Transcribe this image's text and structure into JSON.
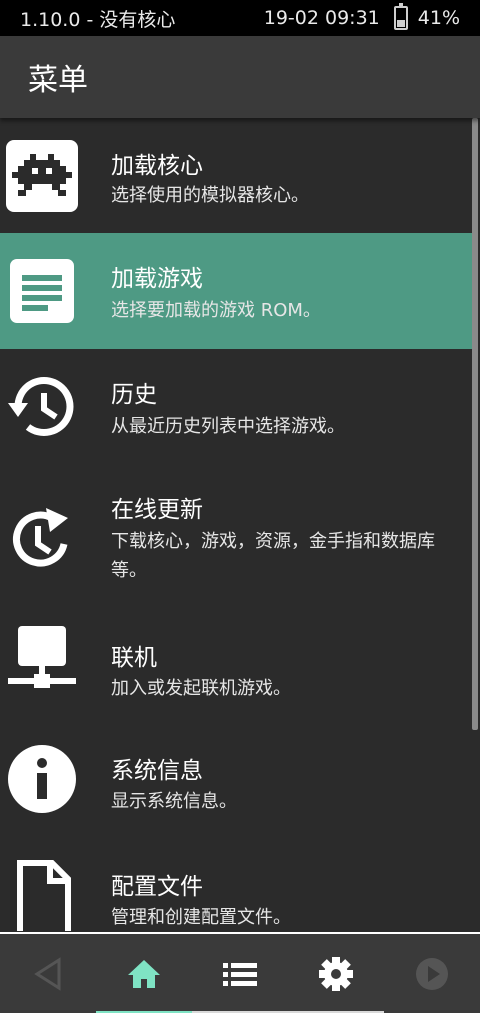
{
  "status_bar": {
    "left_text": "1.10.0 - 没有核心",
    "datetime": "19-02 09:31",
    "battery": "41%",
    "battery_level": 0.41
  },
  "header": {
    "title": "菜单"
  },
  "menu": {
    "items": [
      {
        "title": "加载核心",
        "subtitle": "选择使用的模拟器核心。",
        "icon": "retroarch-invader-icon",
        "selected": false
      },
      {
        "title": "加载游戏",
        "subtitle": "选择要加载的游戏 ROM。",
        "icon": "document-icon",
        "selected": true
      },
      {
        "title": "历史",
        "subtitle": "从最近历史列表中选择游戏。",
        "icon": "history-icon",
        "selected": false
      },
      {
        "title": "在线更新",
        "subtitle": "下载核心，游戏，资源，金手指和数据库等。",
        "icon": "update-icon",
        "selected": false
      },
      {
        "title": "联机",
        "subtitle": "加入或发起联机游戏。",
        "icon": "network-icon",
        "selected": false
      },
      {
        "title": "系统信息",
        "subtitle": "显示系统信息。",
        "icon": "info-icon",
        "selected": false
      },
      {
        "title": "配置文件",
        "subtitle": "管理和创建配置文件。",
        "icon": "file-icon",
        "selected": false
      }
    ]
  },
  "bottom_nav": {
    "items": [
      {
        "icon": "back-triangle-icon"
      },
      {
        "icon": "home-icon",
        "active": true
      },
      {
        "icon": "list-icon"
      },
      {
        "icon": "gear-icon"
      },
      {
        "icon": "play-icon"
      }
    ]
  },
  "colors": {
    "selected_bg": "#4e9a84",
    "active_accent": "#7fe3c4",
    "background": "#2b2b2b",
    "header_bg": "#3a3a3a"
  }
}
